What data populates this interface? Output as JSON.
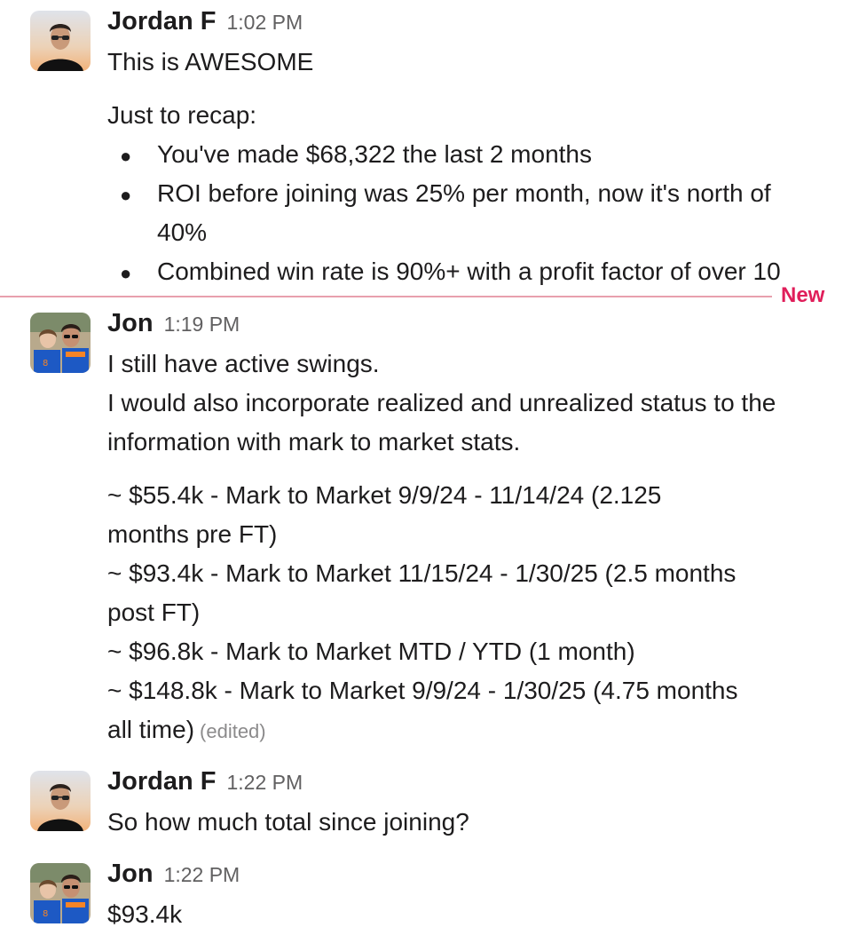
{
  "divider": {
    "label": "New"
  },
  "messages": [
    {
      "author": "Jordan F",
      "time": "1:02 PM",
      "line1": "This is AWESOME",
      "line2": "Just to recap:",
      "bullets": [
        "You've made $68,322 the last 2 months",
        "ROI before joining was 25% per month, now it's north of",
        "40%",
        "Combined win rate is 90%+ with a profit factor of over 10"
      ]
    },
    {
      "author": "Jon",
      "time": "1:19 PM",
      "lines": [
        "I still have active swings.",
        "I would also incorporate realized and unrealized status to the",
        "information with mark to market stats.",
        "~ $55.4k  -  Mark to Market 9/9/24 - 11/14/24 (2.125",
        "months pre FT)",
        "~ $93.4k  -  Mark to Market 11/15/24 - 1/30/25 (2.5 months",
        "post FT)",
        "~ $96.8k  -  Mark to Market MTD / YTD (1 month)",
        "~ $148.8k - Mark to Market 9/9/24 - 1/30/25 (4.75 months",
        "all time)"
      ],
      "edited": "(edited)"
    },
    {
      "author": "Jordan F",
      "time": "1:22 PM",
      "text": "So how much total since joining?"
    },
    {
      "author": "Jon",
      "time": "1:22 PM",
      "text": "$93.4k"
    }
  ]
}
